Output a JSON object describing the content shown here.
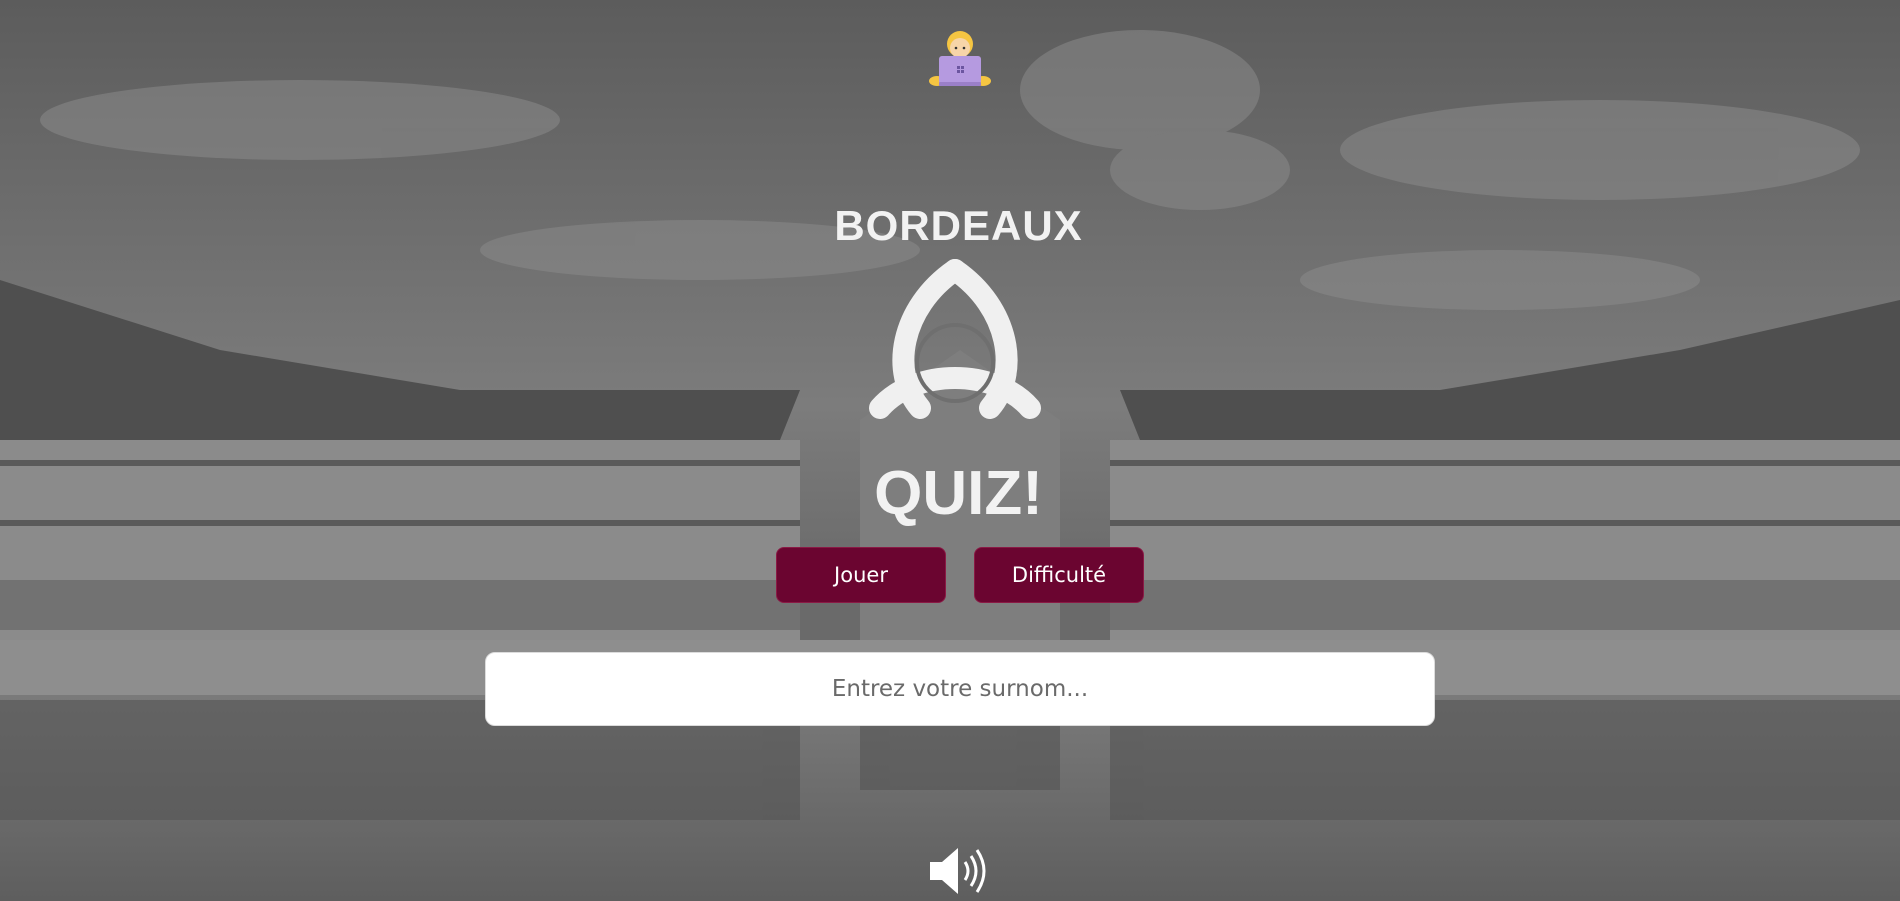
{
  "header": {
    "avatar_icon": "technologist-emoji-icon"
  },
  "title": {
    "top": "BORDEAUX",
    "bottom": "QUIZ!",
    "logo_icon": "triquetra-icon"
  },
  "actions": {
    "play_label": "Jouer",
    "difficulty_label": "Difficulté"
  },
  "nickname": {
    "placeholder": "Entrez votre surnom...",
    "value": ""
  },
  "footer": {
    "sound_icon": "speaker-volume-icon"
  },
  "colors": {
    "button_bg": "#6b0530",
    "text_light": "#f2f2f2",
    "input_bg": "#ffffff"
  }
}
